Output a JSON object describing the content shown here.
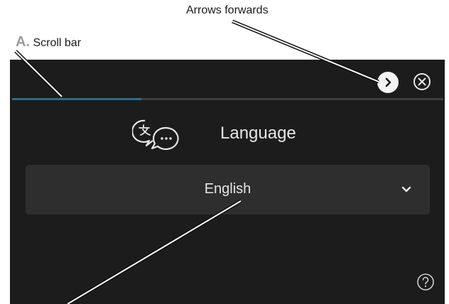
{
  "annotations": {
    "arrows_forwards": "Arrows forwards",
    "scroll_bar_letter": "A.",
    "scroll_bar": "Scroll bar"
  },
  "screen": {
    "title": "Language",
    "language_value": "English",
    "progress_fraction": 0.3,
    "icons": {
      "forward": "chevron-right-icon",
      "close": "close-icon",
      "language": "translate-chat-icon",
      "dropdown": "chevron-down-icon",
      "help": "help-icon"
    },
    "colors": {
      "background": "#1c1c1c",
      "dropdown": "#2e2e2e",
      "progress_fill": "#2a6f86",
      "progress_track": "#3d3d3d",
      "text": "#e6e6e6"
    }
  }
}
